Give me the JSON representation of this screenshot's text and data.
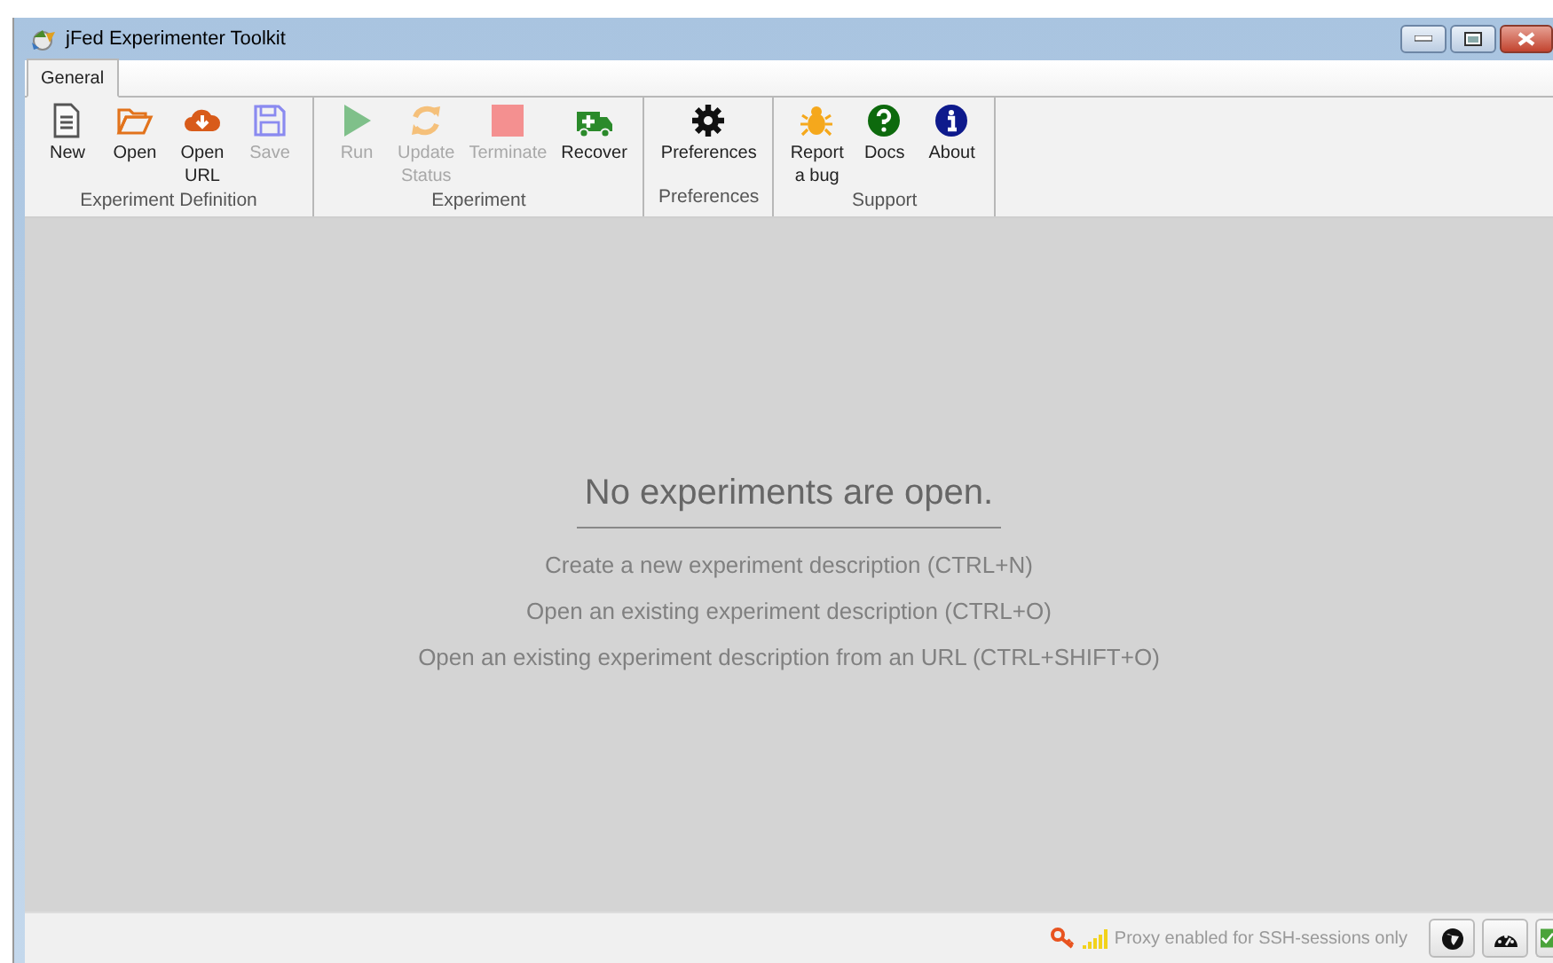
{
  "window": {
    "title": "jFed Experimenter Toolkit"
  },
  "tabs": [
    {
      "label": "General",
      "selected": true
    }
  ],
  "ribbon_groups": [
    {
      "title": "Experiment Definition",
      "buttons": [
        {
          "lines": [
            "New"
          ],
          "disabled": false
        },
        {
          "lines": [
            "Open"
          ],
          "disabled": false
        },
        {
          "lines": [
            "Open",
            "URL"
          ],
          "disabled": false
        },
        {
          "lines": [
            "Save"
          ],
          "disabled": true
        }
      ]
    },
    {
      "title": "Experiment",
      "buttons": [
        {
          "lines": [
            "Run"
          ],
          "disabled": true
        },
        {
          "lines": [
            "Update",
            "Status"
          ],
          "disabled": true
        },
        {
          "lines": [
            "Terminate"
          ],
          "disabled": true
        },
        {
          "lines": [
            "Recover"
          ],
          "disabled": false
        }
      ]
    },
    {
      "title": "Preferences",
      "buttons": [
        {
          "lines": [
            "Preferences"
          ],
          "disabled": false
        }
      ]
    },
    {
      "title": "Support",
      "buttons": [
        {
          "lines": [
            "Report",
            "a bug"
          ],
          "disabled": false
        },
        {
          "lines": [
            "Docs"
          ],
          "disabled": false
        },
        {
          "lines": [
            "About"
          ],
          "disabled": false
        }
      ]
    }
  ],
  "empty_state": {
    "heading": "No experiments are open.",
    "hints": [
      "Create a new experiment description (CTRL+N)",
      "Open an existing experiment description (CTRL+O)",
      "Open an existing experiment description from an URL (CTRL+SHIFT+O)"
    ]
  },
  "status_bar": {
    "proxy_text": "Proxy enabled for SSH-sessions only"
  }
}
